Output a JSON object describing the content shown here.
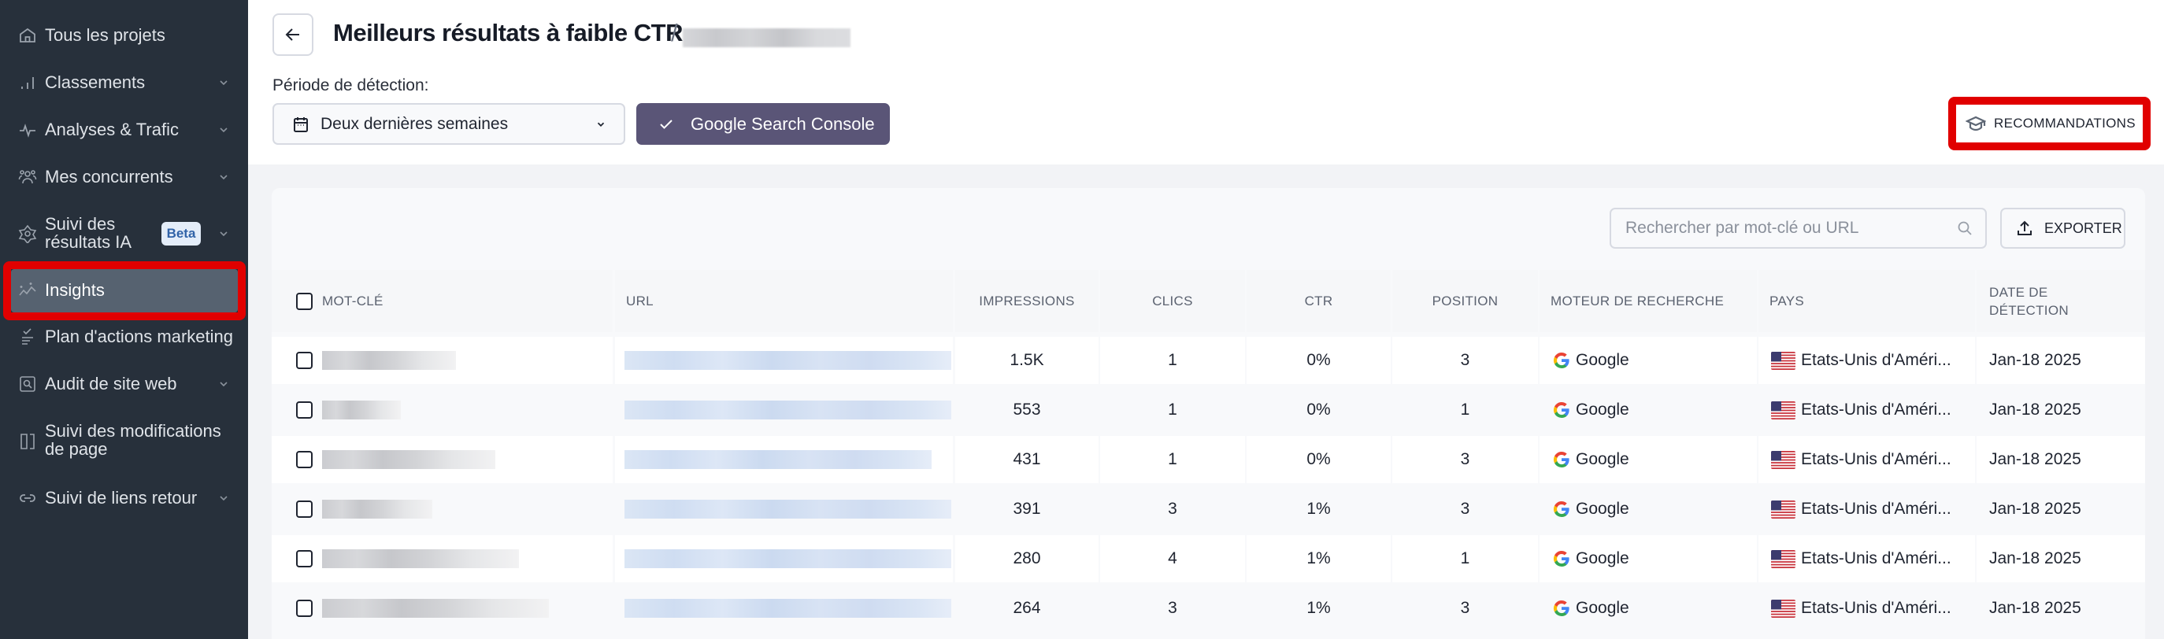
{
  "sidebar": {
    "items": [
      {
        "label": "Tous les projets",
        "icon": "home-icon",
        "has_chevron": false
      },
      {
        "label": "Classements",
        "icon": "bar-chart-icon",
        "has_chevron": true
      },
      {
        "label": "Analyses & Trafic",
        "icon": "pulse-icon",
        "has_chevron": true
      },
      {
        "label": "Mes concurrents",
        "icon": "users-icon",
        "has_chevron": true
      },
      {
        "label_line1": "Suivi des",
        "label_line2": "résultats IA",
        "badge": "Beta",
        "icon": "ai-diamond-icon",
        "has_chevron": true
      },
      {
        "label": "Insights",
        "icon": "sparkle-chart-icon",
        "active": true
      },
      {
        "label": "Plan d'actions marketing",
        "icon": "checklist-icon",
        "has_chevron": false
      },
      {
        "label": "Audit de site web",
        "icon": "site-audit-icon",
        "has_chevron": true
      },
      {
        "label_line1": "Suivi des modifications",
        "label_line2": "de page",
        "icon": "page-changes-icon",
        "has_chevron": false
      },
      {
        "label": "Suivi de liens retour",
        "icon": "link-icon",
        "has_chevron": true
      }
    ]
  },
  "header": {
    "title": "Meilleurs résultats à faible CTR",
    "separator": "/",
    "period_label": "Période de détection:",
    "period_value": "Deux dernières semaines",
    "gsc_button": "Google Search Console",
    "recommendations_button": "RECOMMANDATIONS"
  },
  "toolbar": {
    "search_placeholder": "Rechercher par mot-clé ou URL",
    "export_button": "EXPORTER"
  },
  "table": {
    "columns": [
      "MOT-CLÉ",
      "URL",
      "IMPRESSIONS",
      "CLICS",
      "CTR",
      "POSITION",
      "MOTEUR DE RECHERCHE",
      "PAYS",
      "DATE DE DÉTECTION"
    ],
    "rows": [
      {
        "impressions": "1.5K",
        "clicks": "1",
        "ctr": "0%",
        "position": "3",
        "engine": "Google",
        "country": "Etats-Unis d'Améri...",
        "date": "Jan-18 2025"
      },
      {
        "impressions": "553",
        "clicks": "1",
        "ctr": "0%",
        "position": "1",
        "engine": "Google",
        "country": "Etats-Unis d'Améri...",
        "date": "Jan-18 2025"
      },
      {
        "impressions": "431",
        "clicks": "1",
        "ctr": "0%",
        "position": "3",
        "engine": "Google",
        "country": "Etats-Unis d'Améri...",
        "date": "Jan-18 2025"
      },
      {
        "impressions": "391",
        "clicks": "3",
        "ctr": "1%",
        "position": "3",
        "engine": "Google",
        "country": "Etats-Unis d'Améri...",
        "date": "Jan-18 2025"
      },
      {
        "impressions": "280",
        "clicks": "4",
        "ctr": "1%",
        "position": "1",
        "engine": "Google",
        "country": "Etats-Unis d'Améri...",
        "date": "Jan-18 2025"
      },
      {
        "impressions": "264",
        "clicks": "3",
        "ctr": "1%",
        "position": "3",
        "engine": "Google",
        "country": "Etats-Unis d'Améri...",
        "date": "Jan-18 2025"
      }
    ]
  },
  "colors": {
    "sidebar_bg": "#27303b",
    "active_item_bg": "#566270",
    "highlight_red": "#e10000",
    "gsc_button_bg": "#5a5577",
    "beta_badge_bg": "#e4edf9",
    "beta_badge_text": "#3163a8"
  }
}
